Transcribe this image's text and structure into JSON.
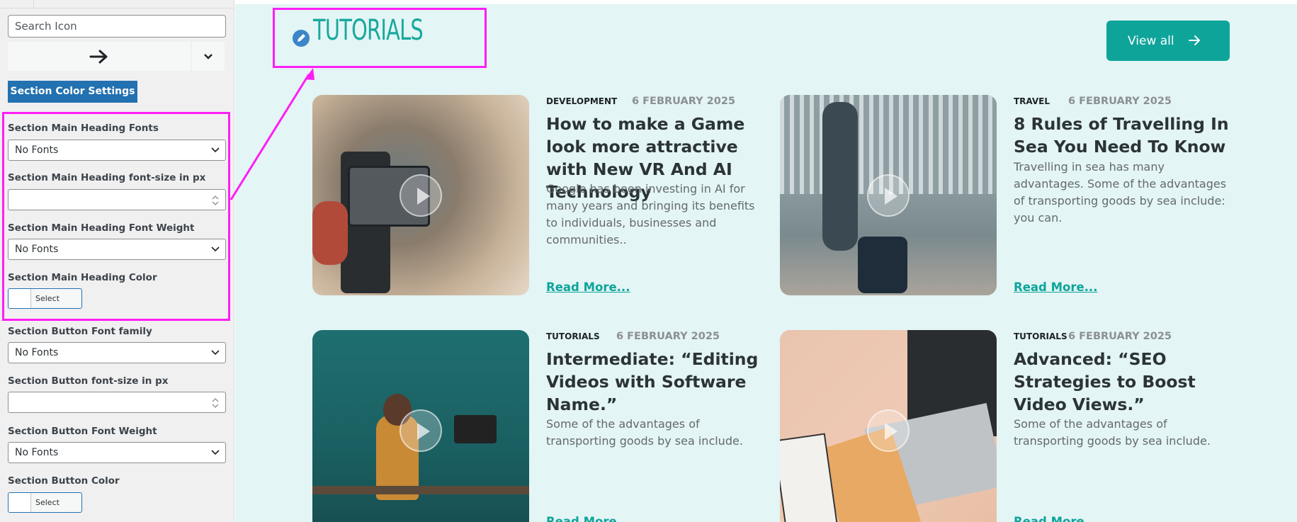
{
  "sidebar": {
    "search_placeholder": "Search Icon",
    "section_color_button": "Section Color Settings",
    "fields": {
      "heading_fonts": {
        "label": "Section Main Heading Fonts",
        "value": "No Fonts"
      },
      "heading_font_size": {
        "label": "Section Main Heading font-size in px",
        "value": ""
      },
      "heading_font_weight": {
        "label": "Section Main Heading Font Weight",
        "value": "No Fonts"
      },
      "heading_color": {
        "label": "Section Main Heading Color",
        "button": "Select Color"
      },
      "button_font_family": {
        "label": "Section Button Font family",
        "value": "No Fonts"
      },
      "button_font_size": {
        "label": "Section Button font-size in px",
        "value": ""
      },
      "button_font_weight": {
        "label": "Section Button Font Weight",
        "value": "No Fonts"
      },
      "button_color": {
        "label": "Section Button Color",
        "button": "Select Color"
      }
    }
  },
  "main": {
    "heading": "TUTORIALS",
    "view_all": "View all",
    "accent_color": "#0ea49a",
    "highlight_color": "#ff1ef5",
    "cards": [
      {
        "category": "DEVELOPMENT",
        "date": "6 FEBRUARY 2025",
        "title": "How to make a Game look more attractive with New VR And AI Technology",
        "excerpt": "Google has been investing in AI for many years and bringing its benefits to individuals, businesses and communities..",
        "read_more": "Read More..."
      },
      {
        "category": "TRAVEL",
        "date": "6 FEBRUARY 2025",
        "title": "8 Rules of Travelling In Sea You Need To Know",
        "excerpt": "Travelling in sea has many advantages. Some of the advantages of transporting goods by sea include: you can.",
        "read_more": "Read More..."
      },
      {
        "category": "TUTORIALS",
        "date": "6 FEBRUARY 2025",
        "title": "Intermediate: “Editing Videos with Software Name.”",
        "excerpt": "Some of the advantages of transporting goods by sea include.",
        "read_more": "Read More..."
      },
      {
        "category": "TUTORIALS",
        "date": "6 FEBRUARY 2025",
        "title": "Advanced: “SEO Strategies to Boost Video Views.”",
        "excerpt": "Some of the advantages of transporting goods by sea include.",
        "read_more": "Read More..."
      }
    ]
  }
}
